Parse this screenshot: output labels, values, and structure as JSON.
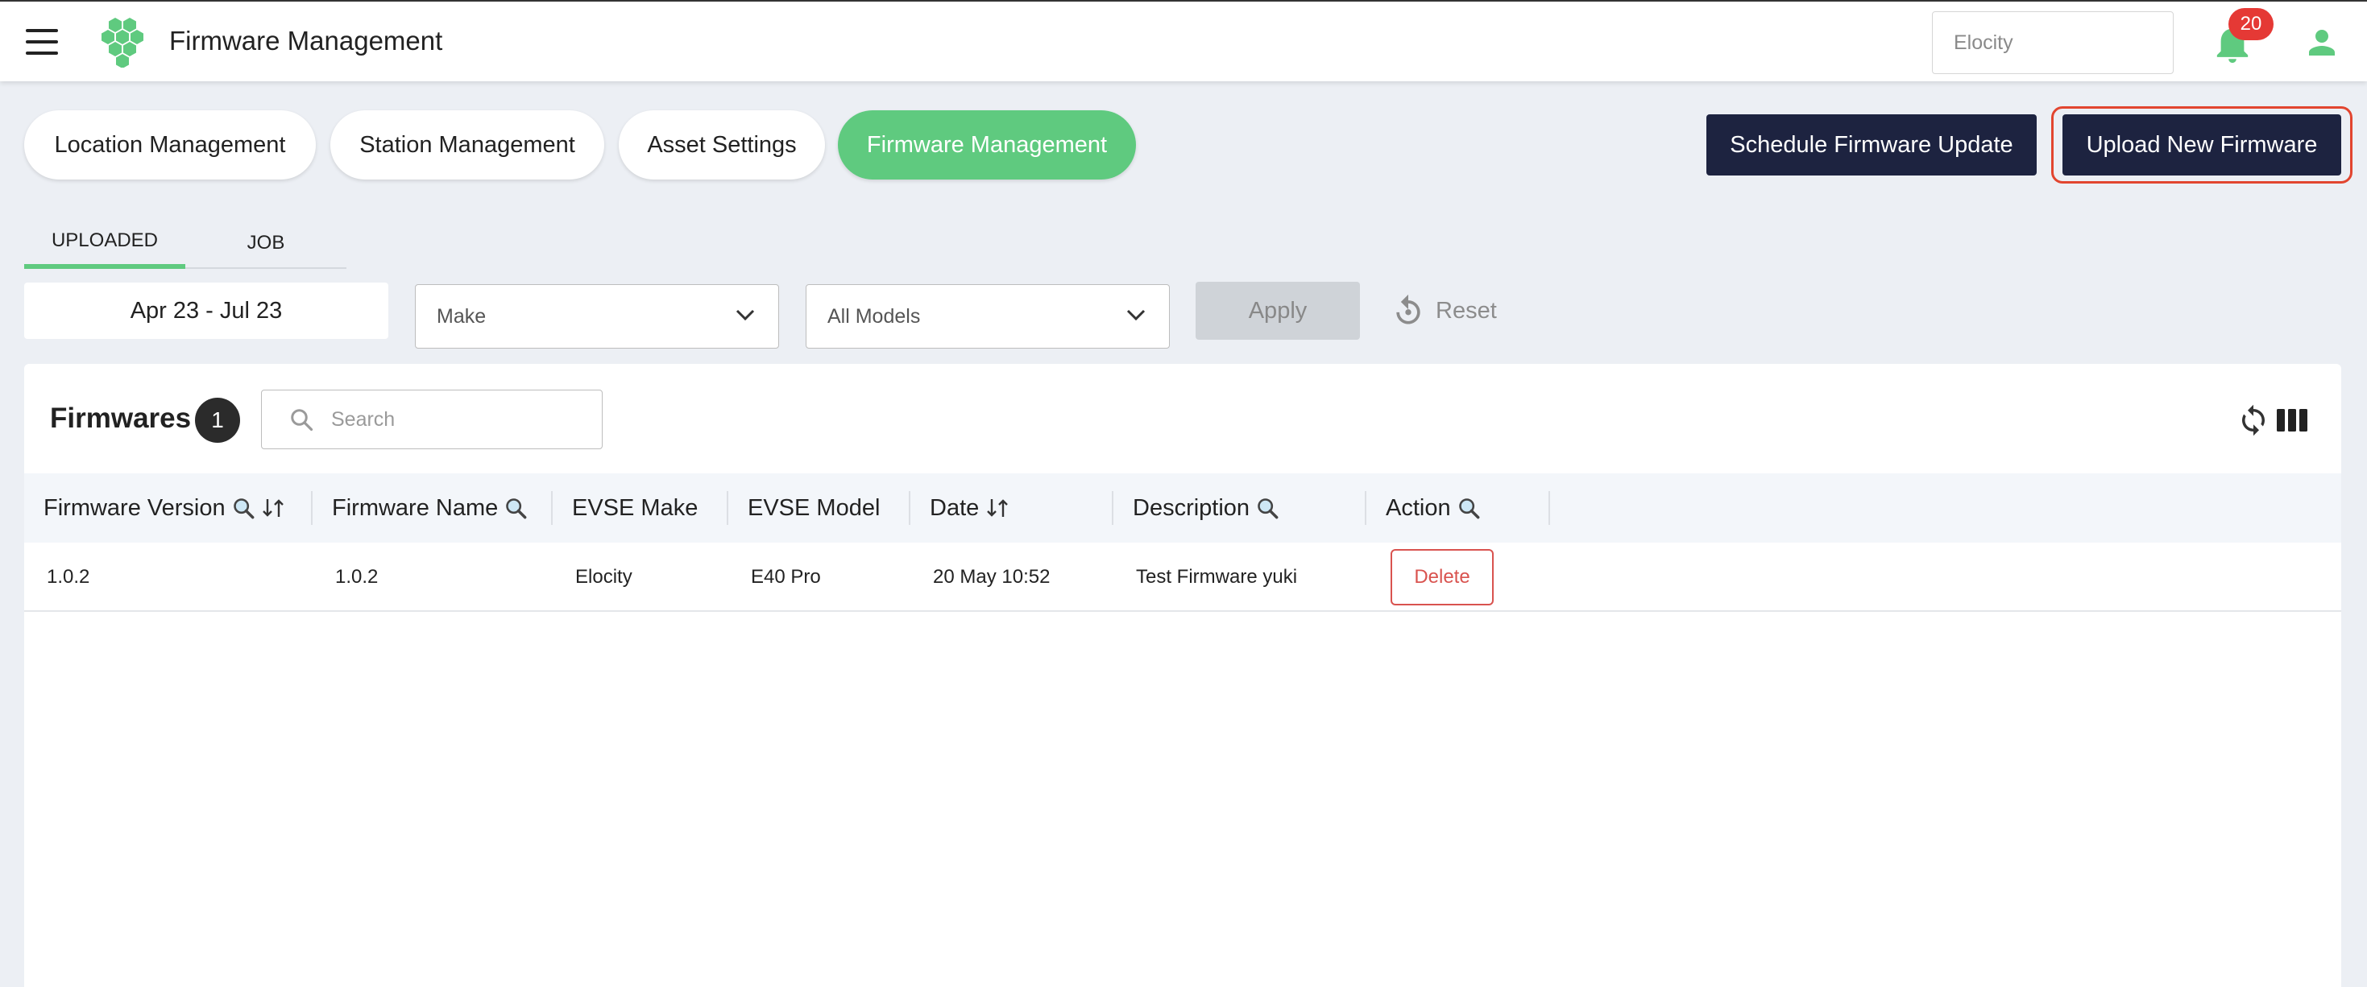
{
  "app": {
    "title": "Firmware Management",
    "organization": "Elocity",
    "notification_count": "20"
  },
  "modules": [
    {
      "label": "Location Management",
      "active": false
    },
    {
      "label": "Station Management",
      "active": false
    },
    {
      "label": "Asset Settings",
      "active": false
    },
    {
      "label": "Firmware Management",
      "active": true
    }
  ],
  "actions": {
    "schedule_label": "Schedule Firmware Update",
    "upload_label": "Upload New Firmware"
  },
  "tabs": [
    {
      "label": "UPLOADED",
      "active": true
    },
    {
      "label": "JOB",
      "active": false
    }
  ],
  "filters": {
    "date_range": "Apr 23 - Jul 23",
    "make": "Make",
    "model": "All Models",
    "apply_label": "Apply",
    "reset_label": "Reset"
  },
  "table": {
    "title": "Firmwares",
    "count": "1",
    "search_placeholder": "Search",
    "columns": [
      "Firmware Version",
      "Firmware Name",
      "EVSE Make",
      "EVSE Model",
      "Date",
      "Description",
      "Action"
    ],
    "rows": [
      {
        "firmware_version": "1.0.2",
        "firmware_name": "1.0.2",
        "evse_make": "Elocity",
        "evse_model": "E40 Pro",
        "date": "20 May 10:52",
        "description": "Test Firmware yuki",
        "action_label": "Delete"
      }
    ]
  },
  "colors": {
    "accent": "#5fca7f",
    "primary_dark": "#1d2340",
    "danger": "#d9534f",
    "badge": "#e53935",
    "highlight": "#e2452f"
  }
}
